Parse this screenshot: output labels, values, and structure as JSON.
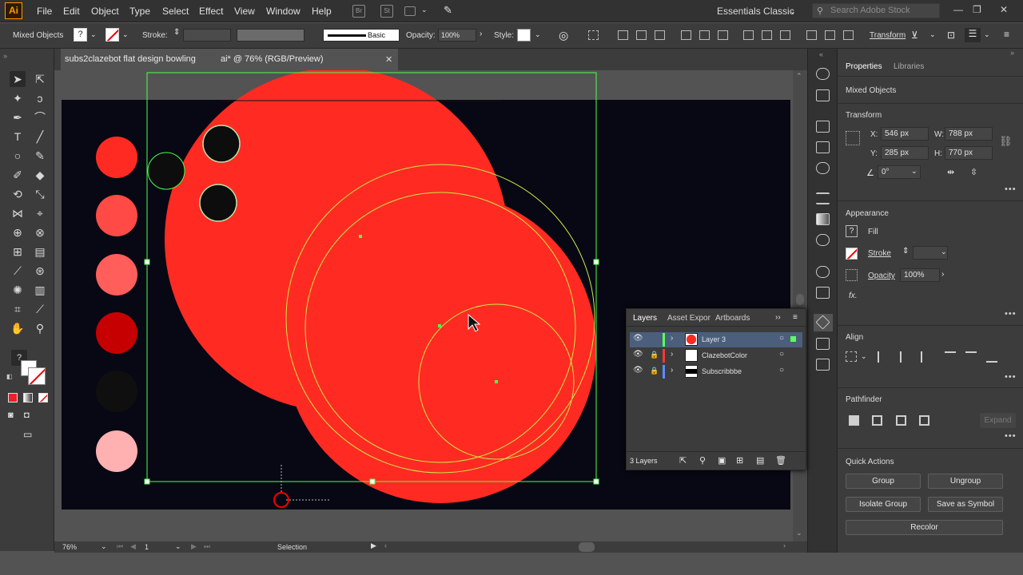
{
  "app": {
    "logo": "Ai",
    "workspace": "Essentials Classic",
    "search_placeholder": "Search Adobe Stock",
    "bridge_label": "Br",
    "stock_label": "St"
  },
  "menu": [
    "File",
    "Edit",
    "Object",
    "Type",
    "Select",
    "Effect",
    "View",
    "Window",
    "Help"
  ],
  "control_bar": {
    "selection_type": "Mixed Objects",
    "stroke_label": "Stroke:",
    "brush_label": "Basic",
    "opacity_label": "Opacity:",
    "opacity_value": "100%",
    "style_label": "Style:",
    "transform_label": "Transform"
  },
  "document": {
    "tab_title": "subs2clazebot flat design bowling ai* @ 76% (RGB/Preview)",
    "tab_title_a": "subs2clazebot flat design bowling",
    "tab_title_b": "ai* @ 76% (RGB/Preview)"
  },
  "status": {
    "zoom": "76%",
    "artboard_number": "1",
    "tool_name": "Selection"
  },
  "swatches": [
    "#ff2b22",
    "#ff4a45",
    "#ff5e5b",
    "#c60000",
    "#0f0f0f",
    "#ffb0b0"
  ],
  "colors": {
    "selection": "#4cff4c",
    "shape_red": "#ff2b22",
    "artboard_bg": "#080814",
    "layer_green": "#5cff5c",
    "layer_red": "#ff3838",
    "layer_blue": "#5f8bff"
  },
  "layers_panel": {
    "tabs": [
      "Layers",
      "Asset Expor",
      "Artboards"
    ],
    "rows": [
      {
        "name": "Layer 3",
        "color": "#5cff5c",
        "selected": true,
        "locked": false
      },
      {
        "name": "ClazebotColor",
        "color": "#ff3838",
        "selected": false,
        "locked": true
      },
      {
        "name": "Subscribbbe",
        "color": "#5f8bff",
        "selected": false,
        "locked": true
      }
    ],
    "count": "3 Layers"
  },
  "properties": {
    "tabs": [
      "Properties",
      "Libraries"
    ],
    "selection_type": "Mixed Objects",
    "transform": {
      "heading": "Transform",
      "x_label": "X:",
      "x": "546 px",
      "y_label": "Y:",
      "y": "285 px",
      "w_label": "W:",
      "w": "788 px",
      "h_label": "H:",
      "h": "770 px",
      "angle": "0°"
    },
    "appearance": {
      "heading": "Appearance",
      "fill": "Fill",
      "stroke": "Stroke",
      "opacity_label": "Opacity",
      "opacity_value": "100%",
      "fx": "fx."
    },
    "align_heading": "Align",
    "pathfinder": {
      "heading": "Pathfinder",
      "expand": "Expand"
    },
    "quick_actions": {
      "heading": "Quick Actions",
      "group": "Group",
      "ungroup": "Ungroup",
      "isolate": "Isolate Group",
      "save_symbol": "Save as Symbol",
      "recolor": "Recolor"
    }
  }
}
